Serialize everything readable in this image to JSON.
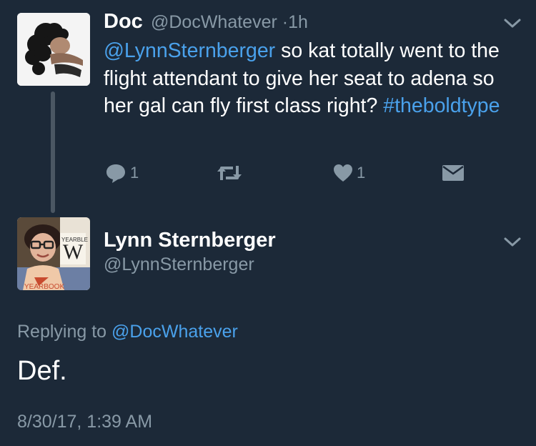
{
  "colors": {
    "background": "#1c2938",
    "muted": "#8899a6",
    "link": "#4aa1eb",
    "thread_line": "#4b5763"
  },
  "tweet1": {
    "name": "Doc",
    "handle": "@DocWhatever",
    "separator": "·",
    "time": "1h",
    "mention": "@LynnSternberger",
    "text": " so kat totally went to the flight attendant to give her seat to adena so her gal can fly first class right? ",
    "hashtag": "#theboldtype",
    "actions": {
      "reply_count": "1",
      "like_count": "1"
    },
    "icons": [
      "reply-icon",
      "retweet-icon",
      "like-icon",
      "dm-icon",
      "chevron-down-icon"
    ]
  },
  "tweet2": {
    "name": "Lynn Sternberger",
    "handle": "@LynnSternberger",
    "replying_label": "Replying to",
    "replying_to": "@DocWhatever",
    "text": "Def.",
    "timestamp": "8/30/17, 1:39 AM",
    "avatar_shirt_text": "YEARBOOK",
    "avatar_sign_text": "YEARBLE"
  }
}
